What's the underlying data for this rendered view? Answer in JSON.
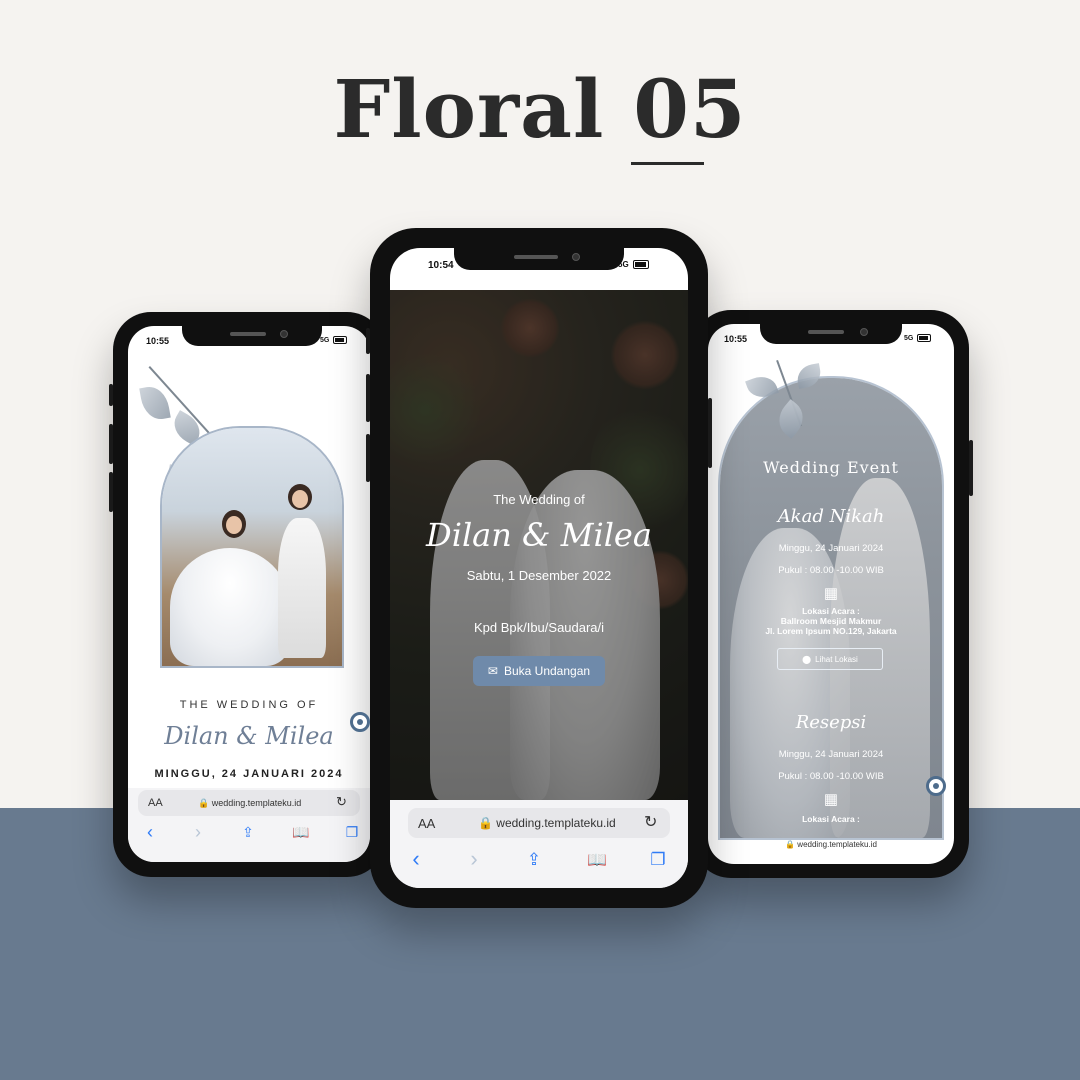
{
  "title": "Floral 05",
  "left_phone": {
    "status_time": "10:55",
    "status_network": "5G",
    "wedding_of": "THE WEDDING OF",
    "names": "Dilan & Milea",
    "date": "MINGGU, 24 JANUARI 2024",
    "browser": {
      "aa": "AA",
      "url": "wedding.templateku.id"
    }
  },
  "center_phone": {
    "status_time": "10:54",
    "status_network": "5G",
    "wedding_of": "The Wedding of",
    "names": "Dilan & Milea",
    "date": "Sabtu, 1 Desember 2022",
    "guest": "Kpd Bpk/Ibu/Saudara/i",
    "open_button": "Buka Undangan",
    "browser": {
      "aa": "AA",
      "url": "wedding.templateku.id"
    }
  },
  "right_phone": {
    "status_time": "10:55",
    "status_network": "5G",
    "heading": "Wedding Event",
    "akad": {
      "title": "Akad Nikah",
      "date": "Minggu, 24 Januari 2024",
      "time": "Pukul : 08.00 -10.00 WIB",
      "location_label": "Lokasi Acara :",
      "venue": "Ballroom Mesjid Makmur",
      "address": "Jl. Lorem Ipsum NO.129, Jakarta",
      "map_button": "Lihat Lokasi"
    },
    "resepsi": {
      "title": "Resepsi",
      "date": "Minggu, 24 Januari 2024",
      "time": "Pukul : 08.00 -10.00 WIB",
      "location_label": "Lokasi Acara :"
    },
    "url": "wedding.templateku.id"
  },
  "colors": {
    "accent": "#6f8aaa",
    "band": "#687a8f",
    "background": "#f5f3f0",
    "ios_blue": "#2f7bf6"
  },
  "icons": [
    "lock-icon",
    "reload-icon",
    "back-icon",
    "forward-icon",
    "share-icon",
    "bookmarks-icon",
    "tabs-icon",
    "envelope-icon",
    "map-icon",
    "pin-icon"
  ]
}
